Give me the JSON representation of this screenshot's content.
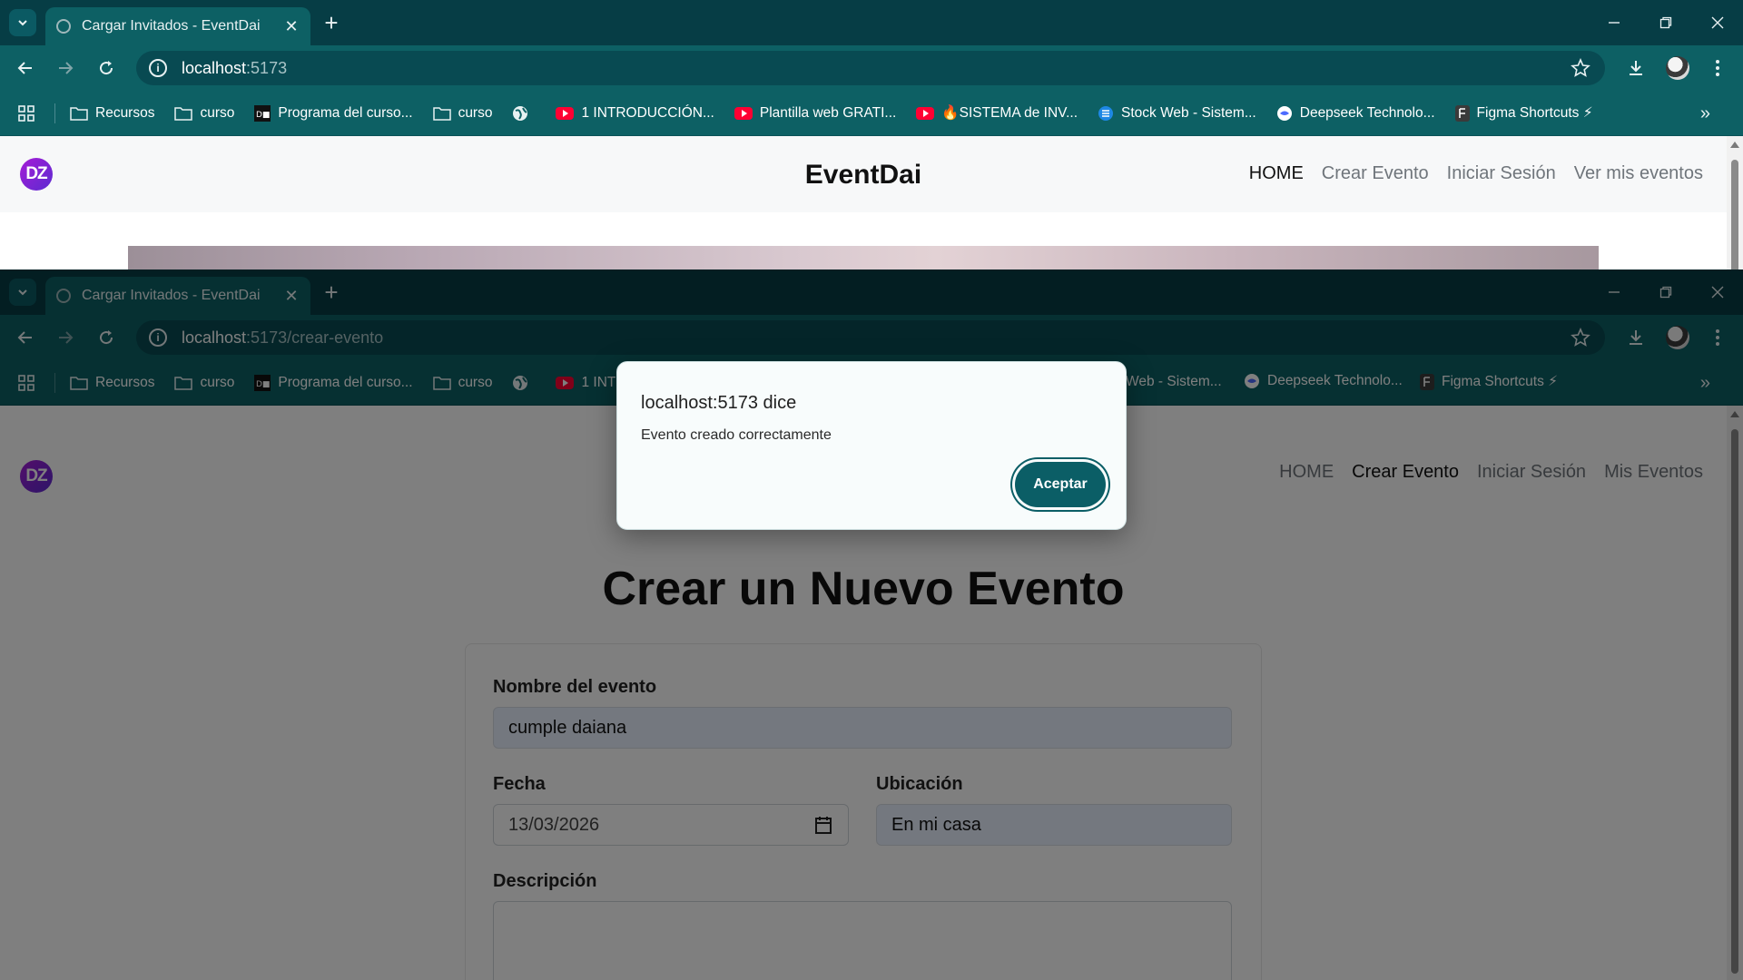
{
  "browser_top": {
    "tab_title": "Cargar Invitados - EventDai",
    "url_host": "localhost",
    "url_rest": ":5173",
    "bookmarks": [
      {
        "label": "Recursos",
        "icon": "folder-icon"
      },
      {
        "label": "curso",
        "icon": "folder-icon"
      },
      {
        "label": "Programa del curso...",
        "icon": "dh-icon"
      },
      {
        "label": "curso",
        "icon": "folder-icon"
      },
      {
        "label": "",
        "icon": "globe-icon"
      },
      {
        "label": "1 INTRODUCCIÓN...",
        "icon": "youtube-icon"
      },
      {
        "label": "Plantilla web GRATI...",
        "icon": "youtube-icon"
      },
      {
        "label": "🔥SISTEMA de INV...",
        "icon": "youtube-icon"
      },
      {
        "label": "Stock Web - Sistem...",
        "icon": "stock-icon"
      },
      {
        "label": "Deepseek Technolo...",
        "icon": "deepseek-icon"
      },
      {
        "label": "Figma Shortcuts ⚡",
        "icon": "figma-icon"
      }
    ]
  },
  "browser_bottom": {
    "tab_title": "Cargar Invitados - EventDai",
    "url_host": "localhost",
    "url_rest": ":5173/crear-evento",
    "bookmarks_left": [
      {
        "label": "Recursos",
        "icon": "folder-icon"
      },
      {
        "label": "curso",
        "icon": "folder-icon"
      },
      {
        "label": "Programa del curso...",
        "icon": "dh-icon"
      },
      {
        "label": "curso",
        "icon": "folder-icon"
      },
      {
        "label": "",
        "icon": "globe-icon"
      },
      {
        "label": "1 INTRC",
        "icon": "youtube-icon"
      }
    ],
    "bookmarks_right": [
      {
        "label": "Web - Sistem...",
        "icon": ""
      },
      {
        "label": "Deepseek Technolo...",
        "icon": "deepseek-icon"
      },
      {
        "label": "Figma Shortcuts ⚡",
        "icon": "figma-icon"
      }
    ]
  },
  "site_top": {
    "logo": "DZ",
    "brand": "EventDai",
    "nav": [
      "HOME",
      "Crear Evento",
      "Iniciar Sesión",
      "Ver mis eventos"
    ],
    "active_nav": "HOME"
  },
  "site_bottom": {
    "logo": "DZ",
    "nav": [
      "HOME",
      "Crear Evento",
      "Iniciar Sesión",
      "Mis Eventos"
    ],
    "active_nav": "Crear Evento",
    "heading": "Crear un Nuevo Evento",
    "form": {
      "name_label": "Nombre del evento",
      "name_value": "cumple daiana",
      "date_label": "Fecha",
      "date_value": "13/03/2026",
      "location_label": "Ubicación",
      "location_value": "En mi casa",
      "description_label": "Descripción",
      "description_value": ""
    }
  },
  "dialog": {
    "title": "localhost:5173 dice",
    "message": "Evento creado correctamente",
    "button": "Aceptar"
  },
  "colors": {
    "chrome_dark": "#063d45",
    "chrome": "#0d6064",
    "accent_button": "#0b5e66",
    "logo_gradient_start": "#a51cd6",
    "logo_gradient_end": "#5b2bd1"
  }
}
